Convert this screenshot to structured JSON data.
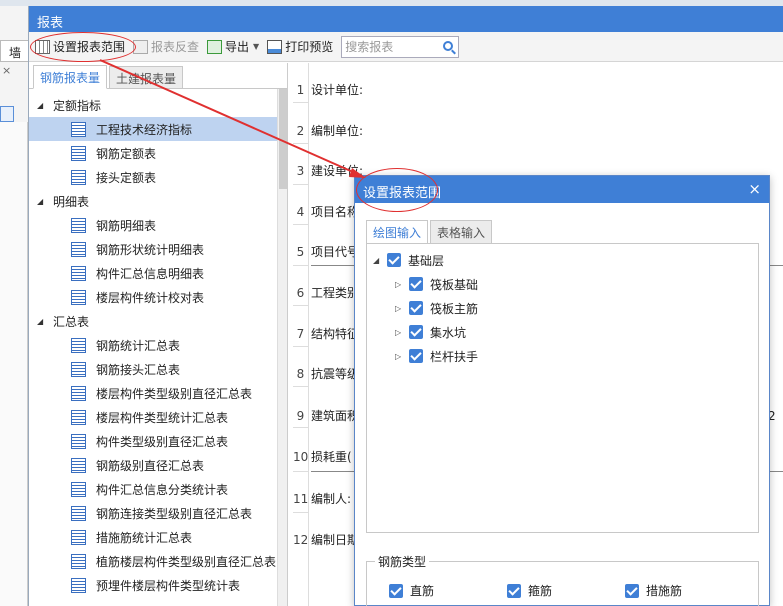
{
  "background": {
    "tab_label": "墙",
    "close_mark": "×"
  },
  "window": {
    "title": "报表"
  },
  "toolbar": {
    "set_range": "设置报表范围",
    "review": "报表反查",
    "export": "导出",
    "print_preview": "打印预览",
    "search_placeholder": "搜索报表"
  },
  "left_panel": {
    "tabs": [
      "钢筋报表量",
      "土建报表量"
    ],
    "groups": [
      {
        "label": "定额指标",
        "items": [
          "工程技术经济指标",
          "钢筋定额表",
          "接头定额表"
        ]
      },
      {
        "label": "明细表",
        "items": [
          "钢筋明细表",
          "钢筋形状统计明细表",
          "构件汇总信息明细表",
          "楼层构件统计校对表"
        ]
      },
      {
        "label": "汇总表",
        "items": [
          "钢筋统计汇总表",
          "钢筋接头汇总表",
          "楼层构件类型级别直径汇总表",
          "楼层构件类型统计汇总表",
          "构件类型级别直径汇总表",
          "钢筋级别直径汇总表",
          "构件汇总信息分类统计表",
          "钢筋连接类型级别直径汇总表",
          "措施筋统计汇总表",
          "植筋楼层构件类型级别直径汇总表",
          "预埋件楼层构件类型统计表"
        ]
      }
    ]
  },
  "sheet": {
    "rows": [
      {
        "num": "1",
        "label": "设计单位:"
      },
      {
        "num": "2",
        "label": "编制单位:"
      },
      {
        "num": "3",
        "label": "建设单位:"
      },
      {
        "num": "4",
        "label": "项目名称"
      },
      {
        "num": "5",
        "label": "项目代号"
      },
      {
        "num": "6",
        "label": "工程类别"
      },
      {
        "num": "7",
        "label": "结构特征"
      },
      {
        "num": "8",
        "label": "抗震等级"
      },
      {
        "num": "9",
        "label": "建筑面积"
      },
      {
        "num": "10",
        "label": "损耗重("
      },
      {
        "num": "11",
        "label": "编制人:"
      },
      {
        "num": "12",
        "label": "编制日期"
      }
    ],
    "edge_value": "2"
  },
  "dialog": {
    "title": "设置报表范围",
    "close": "×",
    "tabs": [
      "绘图输入",
      "表格输入"
    ],
    "root": "基础层",
    "children": [
      "筏板基础",
      "筏板主筋",
      "集水坑",
      "栏杆扶手"
    ],
    "rebar_group_label": "钢筋类型",
    "rebar_types": [
      "直筋",
      "箍筋",
      "措施筋"
    ]
  },
  "colors": {
    "title_bar": "#3f7fd6",
    "selected_row": "#bed3f0",
    "annotation": "#e03030"
  }
}
